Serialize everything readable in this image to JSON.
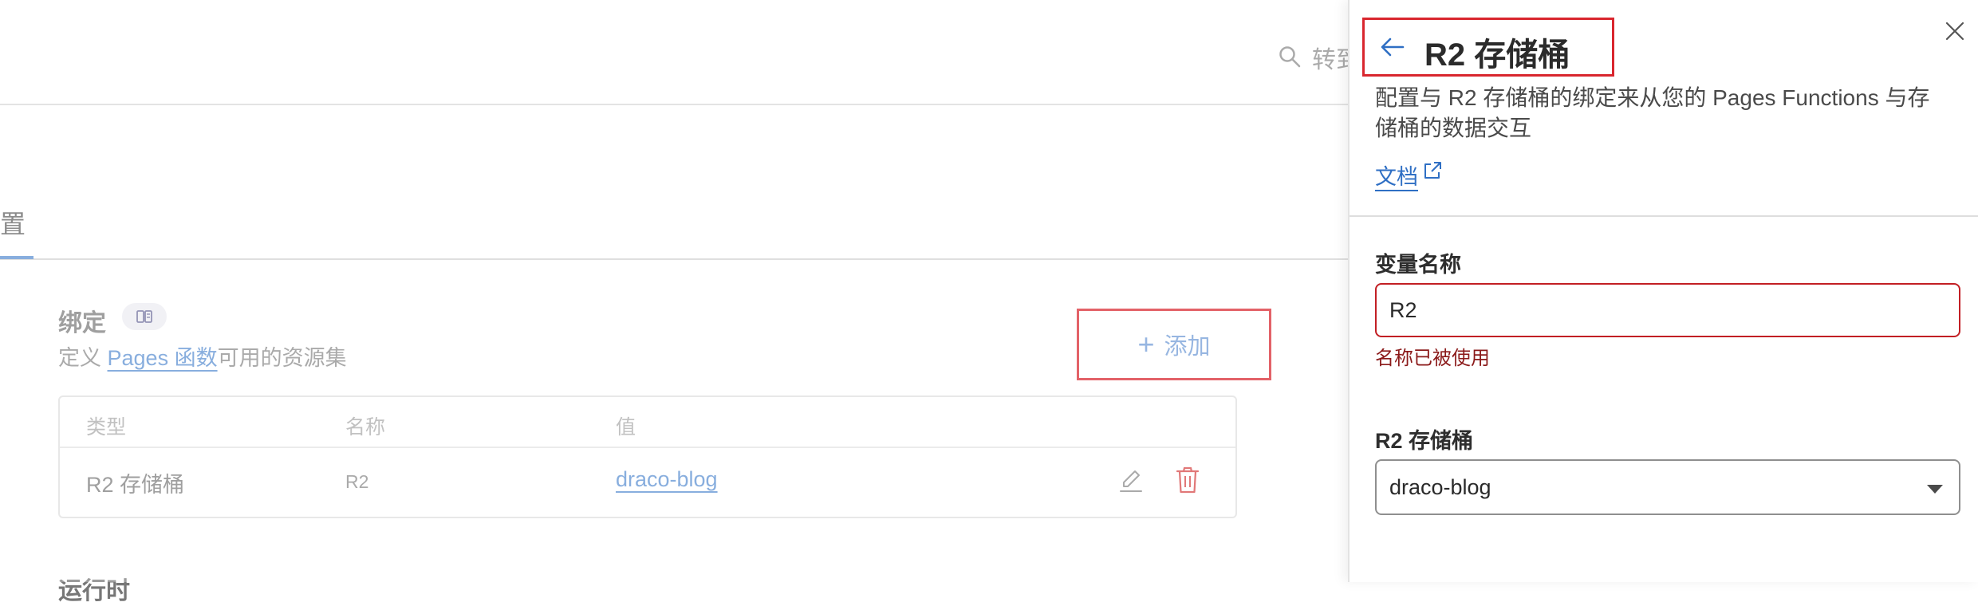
{
  "header": {
    "search_text": "转到"
  },
  "tabs": {
    "partial_label": "置"
  },
  "bindings": {
    "title": "绑定",
    "desc_prefix": "定义 ",
    "desc_link": "Pages 函数",
    "desc_suffix": "可用的资源集",
    "add_label": "添加",
    "columns": [
      "类型",
      "名称",
      "值"
    ],
    "rows": [
      {
        "type": "R2 存储桶",
        "name": "R2",
        "value": "draco-blog"
      }
    ],
    "next_section_title": "运行时"
  },
  "panel": {
    "title": "R2 存储桶",
    "description": "配置与 R2 存储桶的绑定来从您的 Pages Functions 与存储桶的数据交互",
    "docs_label": "文档",
    "variable_label": "变量名称",
    "variable_value": "R2",
    "variable_error": "名称已被使用",
    "bucket_label": "R2 存储桶",
    "bucket_value": "draco-blog"
  },
  "colors": {
    "highlight_border": "#d9262e",
    "link": "#5b8fd1",
    "error": "#8b1a1a"
  },
  "icons": [
    "search-icon",
    "book-icon",
    "plus-icon",
    "edit-icon",
    "trash-icon",
    "back-arrow-icon",
    "close-icon",
    "external-link-icon",
    "chevron-down-icon"
  ]
}
